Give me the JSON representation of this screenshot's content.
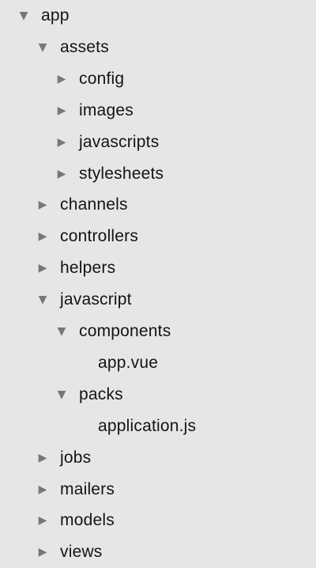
{
  "tree": [
    {
      "label": "app",
      "depth": 0,
      "state": "expanded"
    },
    {
      "label": "assets",
      "depth": 1,
      "state": "expanded"
    },
    {
      "label": "config",
      "depth": 2,
      "state": "collapsed"
    },
    {
      "label": "images",
      "depth": 2,
      "state": "collapsed"
    },
    {
      "label": "javascripts",
      "depth": 2,
      "state": "collapsed"
    },
    {
      "label": "stylesheets",
      "depth": 2,
      "state": "collapsed"
    },
    {
      "label": "channels",
      "depth": 1,
      "state": "collapsed"
    },
    {
      "label": "controllers",
      "depth": 1,
      "state": "collapsed"
    },
    {
      "label": "helpers",
      "depth": 1,
      "state": "collapsed"
    },
    {
      "label": "javascript",
      "depth": 1,
      "state": "expanded"
    },
    {
      "label": "components",
      "depth": 2,
      "state": "expanded"
    },
    {
      "label": "app.vue",
      "depth": 3,
      "state": "leaf"
    },
    {
      "label": "packs",
      "depth": 2,
      "state": "expanded"
    },
    {
      "label": "application.js",
      "depth": 3,
      "state": "leaf"
    },
    {
      "label": "jobs",
      "depth": 1,
      "state": "collapsed"
    },
    {
      "label": "mailers",
      "depth": 1,
      "state": "collapsed"
    },
    {
      "label": "models",
      "depth": 1,
      "state": "collapsed"
    },
    {
      "label": "views",
      "depth": 1,
      "state": "collapsed"
    }
  ],
  "icons": {
    "expanded": "disclosure-triangle-down-icon",
    "collapsed": "disclosure-triangle-right-icon"
  },
  "colors": {
    "background": "#e6e6e6",
    "text": "#141414",
    "triangle": "#777777"
  }
}
